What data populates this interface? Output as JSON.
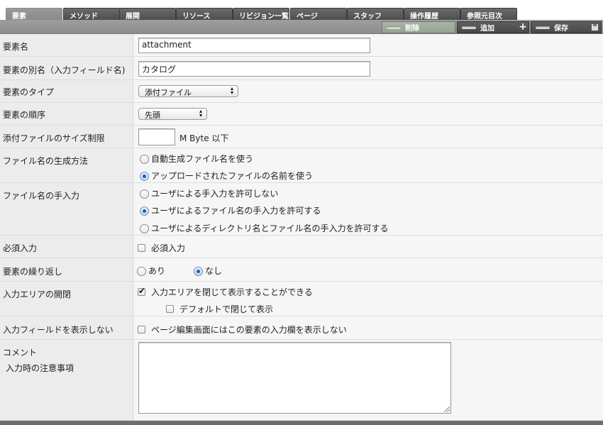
{
  "tabs": [
    "要素",
    "メソッド",
    "展開",
    "リソース",
    "リビジョン一覧",
    "ページ",
    "スタッフ",
    "操作履歴",
    "参照元目次"
  ],
  "toolbar": {
    "delete_label": "削除",
    "add_label": "追加",
    "save_label": "保存"
  },
  "fields": {
    "element_name": {
      "label": "要素名",
      "value": "attachment"
    },
    "alias": {
      "label": "要素の別名（入力フィールド名)",
      "value": "カタログ"
    },
    "type": {
      "label": "要素のタイプ",
      "selected": "添付ファイル"
    },
    "order": {
      "label": "要素の順序",
      "selected": "先頭"
    },
    "size_limit": {
      "label": "添付ファイルのサイズ制限",
      "value": "",
      "unit": "M Byte 以下"
    },
    "filename_method": {
      "label": "ファイル名の生成方法",
      "options": [
        "自動生成ファイル名を使う",
        "アップロードされたファイルの名前を使う"
      ],
      "selected_index": 1
    },
    "manual_input": {
      "label": "ファイル名の手入力",
      "options": [
        "ユーザによる手入力を許可しない",
        "ユーザによるファイル名の手入力を許可する",
        "ユーザによるディレクトリ名とファイル名の手入力を許可する"
      ],
      "selected_index": 1
    },
    "required": {
      "label": "必須入力",
      "checkbox_label": "必須入力",
      "checked": false
    },
    "repeat": {
      "label": "要素の繰り返し",
      "options": [
        "あり",
        "なし"
      ],
      "selected_index": 1
    },
    "collapse": {
      "label": "入力エリアの開閉",
      "checkbox_label": "入力エリアを閉じて表示することができる",
      "checked": true,
      "sub_checkbox_label": "デフォルトで閉じて表示",
      "sub_checked": false
    },
    "hide_field": {
      "label": "入力フィールドを表示しない",
      "checkbox_label": "ページ編集画面にはこの要素の入力欄を表示しない",
      "checked": false
    },
    "comment": {
      "label": "コメント",
      "sublabel": "入力時の注意事項",
      "value": ""
    }
  },
  "colors": {
    "tab_bg": "#555555",
    "toolbar_bg": "#949494",
    "label_bg": "#ececec",
    "radio_accent": "#1f5fae"
  }
}
